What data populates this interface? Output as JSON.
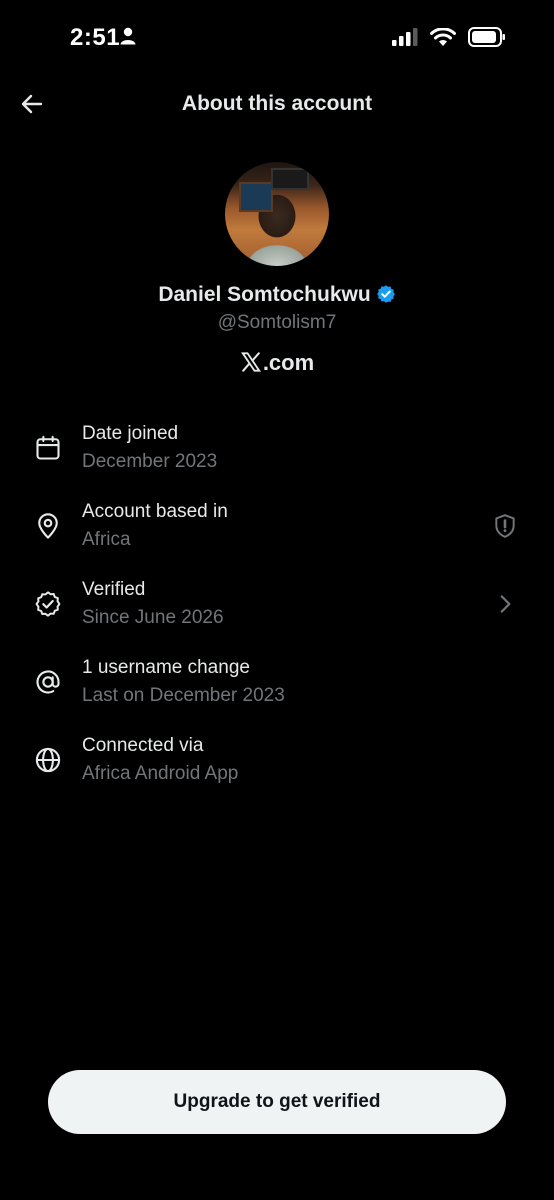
{
  "status_bar": {
    "time": "2:51"
  },
  "header": {
    "title": "About this account"
  },
  "profile": {
    "name": "Daniel Somtochukwu",
    "handle": "@Somtolism7",
    "site_text": ".com",
    "verified_color": "#1d9bf0"
  },
  "info": {
    "date_joined": {
      "title": "Date joined",
      "value": "December 2023",
      "icon": "calendar-icon"
    },
    "based_in": {
      "title": "Account based in",
      "value": "Africa",
      "icon": "location-pin-icon",
      "trailing_icon": "shield-alert-icon"
    },
    "verified": {
      "title": "Verified",
      "value": "Since June 2026",
      "icon": "verified-badge-icon",
      "trailing_icon": "chevron-right-icon"
    },
    "username_change": {
      "title": "1 username change",
      "value": "Last on December 2023",
      "icon": "at-sign-icon"
    },
    "connected_via": {
      "title": "Connected via",
      "value": "Africa Android App",
      "icon": "globe-icon"
    }
  },
  "upgrade_button": {
    "label": "Upgrade to get verified"
  },
  "colors": {
    "background": "#000000",
    "primary_text": "#e7e9ea",
    "secondary_text": "#71767b",
    "button_bg": "#eff3f4",
    "button_text": "#0f1419"
  }
}
